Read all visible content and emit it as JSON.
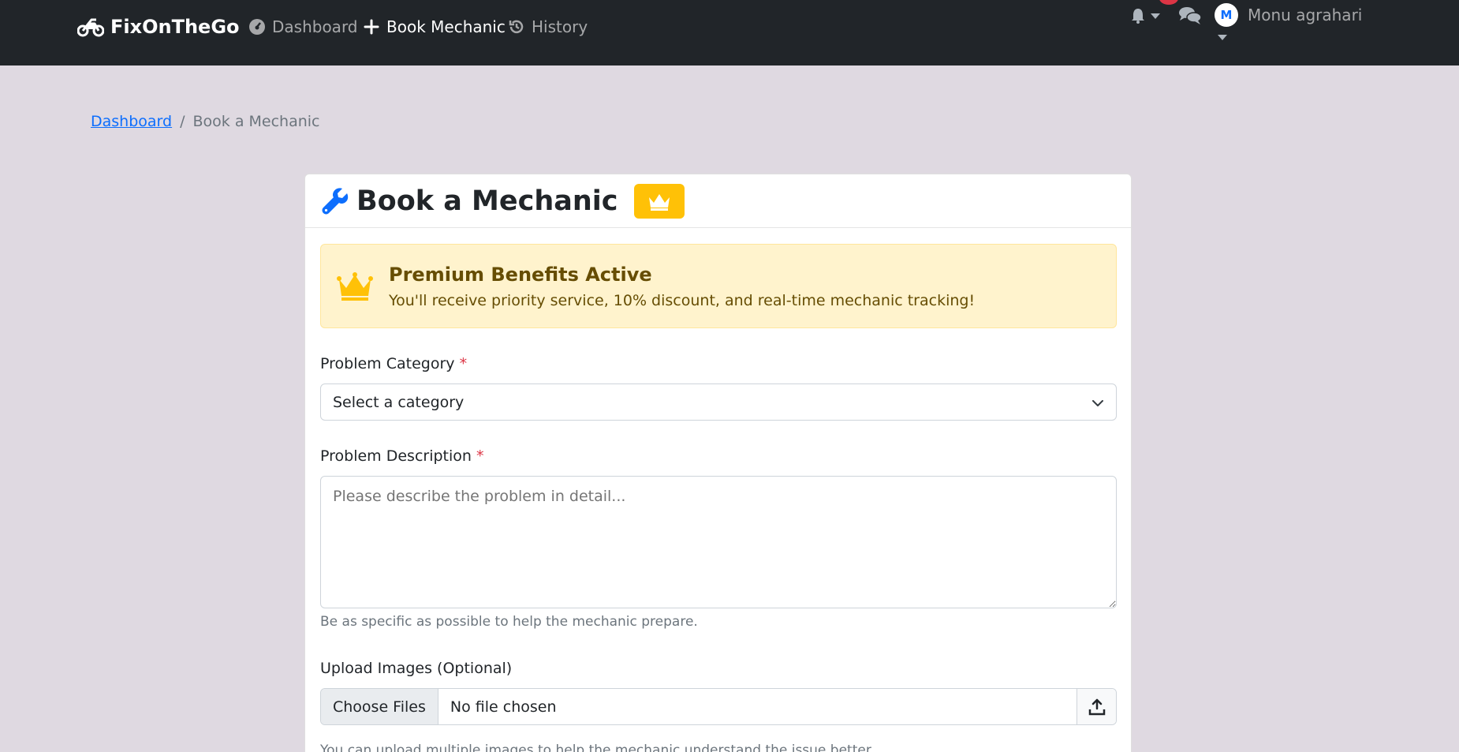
{
  "navbar": {
    "brand": "FixOnTheGo",
    "links": [
      {
        "label": "Dashboard",
        "icon": "gauge-icon"
      },
      {
        "label": "Book Mechanic",
        "icon": "plus-icon"
      },
      {
        "label": "History",
        "icon": "history-icon"
      }
    ],
    "user": {
      "initial": "M",
      "name": "Monu agrahari"
    }
  },
  "breadcrumb": {
    "home": "Dashboard",
    "separator": "/",
    "current": "Book a Mechanic"
  },
  "card": {
    "title": "Book a Mechanic",
    "alert": {
      "title": "Premium Benefits Active",
      "text": "You'll receive priority service, 10% discount, and real-time mechanic tracking!"
    },
    "category": {
      "label": "Problem Category",
      "required": "*",
      "selected": "Select a category"
    },
    "description": {
      "label": "Problem Description",
      "required": "*",
      "placeholder": "Please describe the problem in detail...",
      "help": "Be as specific as possible to help the mechanic prepare."
    },
    "upload": {
      "label": "Upload Images (Optional)",
      "button": "Choose Files",
      "status": "No file chosen",
      "help": "You can upload multiple images to help the mechanic understand the issue better."
    }
  },
  "colors": {
    "navbar": "#212529",
    "accent": "#0d6efd",
    "premium": "#ffc107",
    "alert_bg": "#fff3cd"
  }
}
